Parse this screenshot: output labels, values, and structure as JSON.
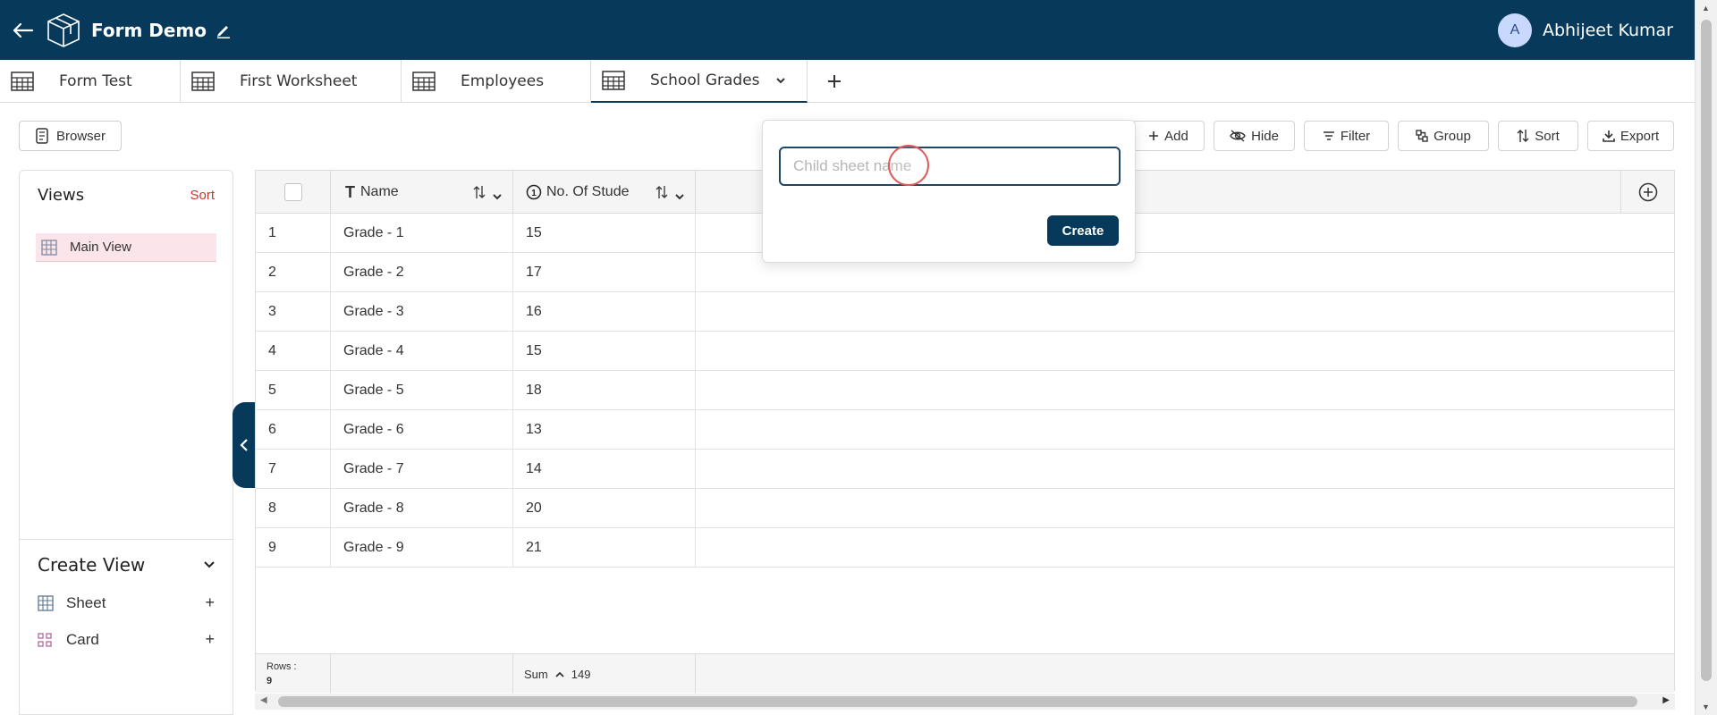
{
  "header": {
    "title": "Form Demo",
    "user_initial": "A",
    "user_name": "Abhijeet Kumar"
  },
  "tabs": [
    {
      "label": "Form Test"
    },
    {
      "label": "First Worksheet"
    },
    {
      "label": "Employees"
    },
    {
      "label": "School Grades"
    }
  ],
  "browser_label": "Browser",
  "toolbar": {
    "add": "Add",
    "hide": "Hide",
    "filter": "Filter",
    "group": "Group",
    "sort": "Sort",
    "export": "Export"
  },
  "views": {
    "title": "Views",
    "sort_label": "Sort",
    "items": [
      {
        "label": "Main View"
      }
    ]
  },
  "create_view": {
    "title": "Create View",
    "items": [
      {
        "label": "Sheet"
      },
      {
        "label": "Card"
      }
    ]
  },
  "grid": {
    "columns": [
      "Name",
      "No. Of Stude"
    ],
    "rows": [
      {
        "num": "1",
        "name": "Grade - 1",
        "students": "15"
      },
      {
        "num": "2",
        "name": "Grade - 2",
        "students": "17"
      },
      {
        "num": "3",
        "name": "Grade - 3",
        "students": "16"
      },
      {
        "num": "4",
        "name": "Grade - 4",
        "students": "15"
      },
      {
        "num": "5",
        "name": "Grade - 5",
        "students": "18"
      },
      {
        "num": "6",
        "name": "Grade - 6",
        "students": "13"
      },
      {
        "num": "7",
        "name": "Grade - 7",
        "students": "14"
      },
      {
        "num": "8",
        "name": "Grade - 8",
        "students": "20"
      },
      {
        "num": "9",
        "name": "Grade - 9",
        "students": "21"
      }
    ],
    "footer": {
      "rows_label": "Rows :",
      "rows_count": "9",
      "sum_label": "Sum",
      "sum_value": "149"
    }
  },
  "popup": {
    "placeholder": "Child sheet name",
    "create_label": "Create"
  },
  "colors": {
    "primary": "#073a5a",
    "accent": "#c0392b",
    "view_highlight": "#fbe4ea"
  }
}
